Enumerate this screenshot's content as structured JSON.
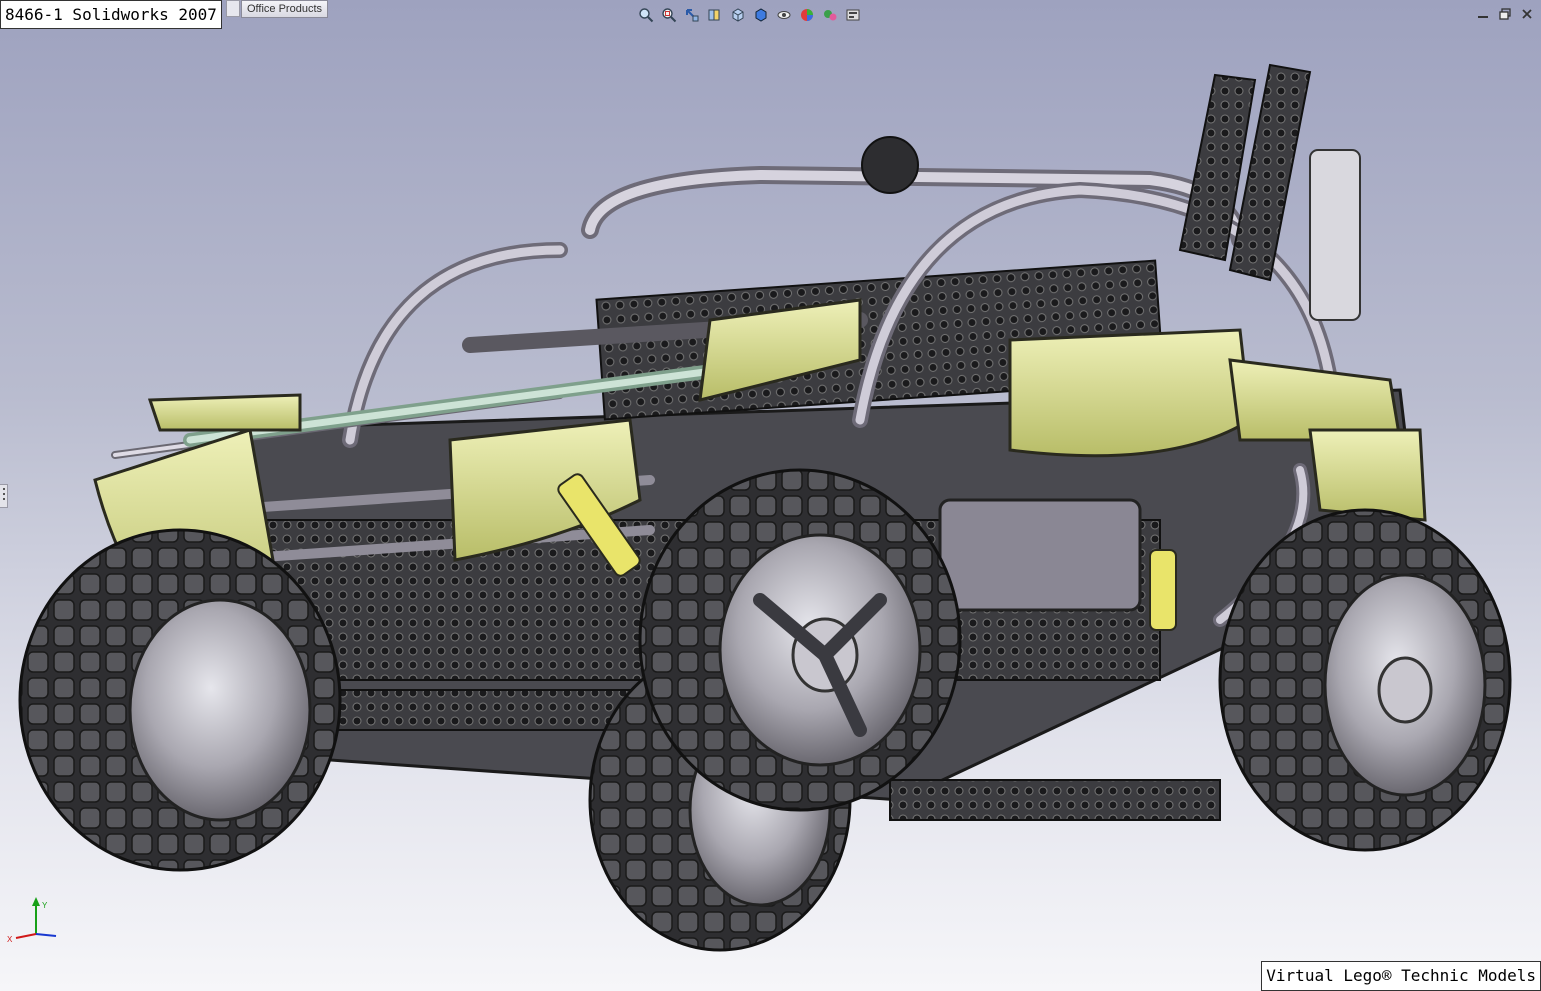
{
  "window": {
    "title": "8466-1 Solidworks 2007",
    "tab_label": "Office Products"
  },
  "view_toolbar": {
    "buttons": [
      {
        "icon": "zoom-to-fit-icon"
      },
      {
        "icon": "zoom-to-area-icon"
      },
      {
        "icon": "previous-view-icon"
      },
      {
        "icon": "section-view-icon"
      },
      {
        "icon": "view-orientation-icon"
      },
      {
        "icon": "display-style-icon"
      },
      {
        "icon": "hide-show-items-icon"
      },
      {
        "icon": "edit-appearance-icon"
      },
      {
        "icon": "apply-scene-icon"
      },
      {
        "icon": "view-settings-icon"
      }
    ]
  },
  "window_controls": [
    "minimize-icon",
    "restore-icon",
    "close-icon"
  ],
  "triad": {
    "x_label": "X",
    "y_label": "Y",
    "x_color": "#d01818",
    "y_color": "#18a018",
    "z_color": "#1838d0"
  },
  "model": {
    "description_icon": "lego-technic-buggy-assembly",
    "accent_color": "#d6dc8c",
    "tire_color": "#2a2a2a"
  },
  "watermark": {
    "text": "Virtual Lego® Technic Models"
  }
}
